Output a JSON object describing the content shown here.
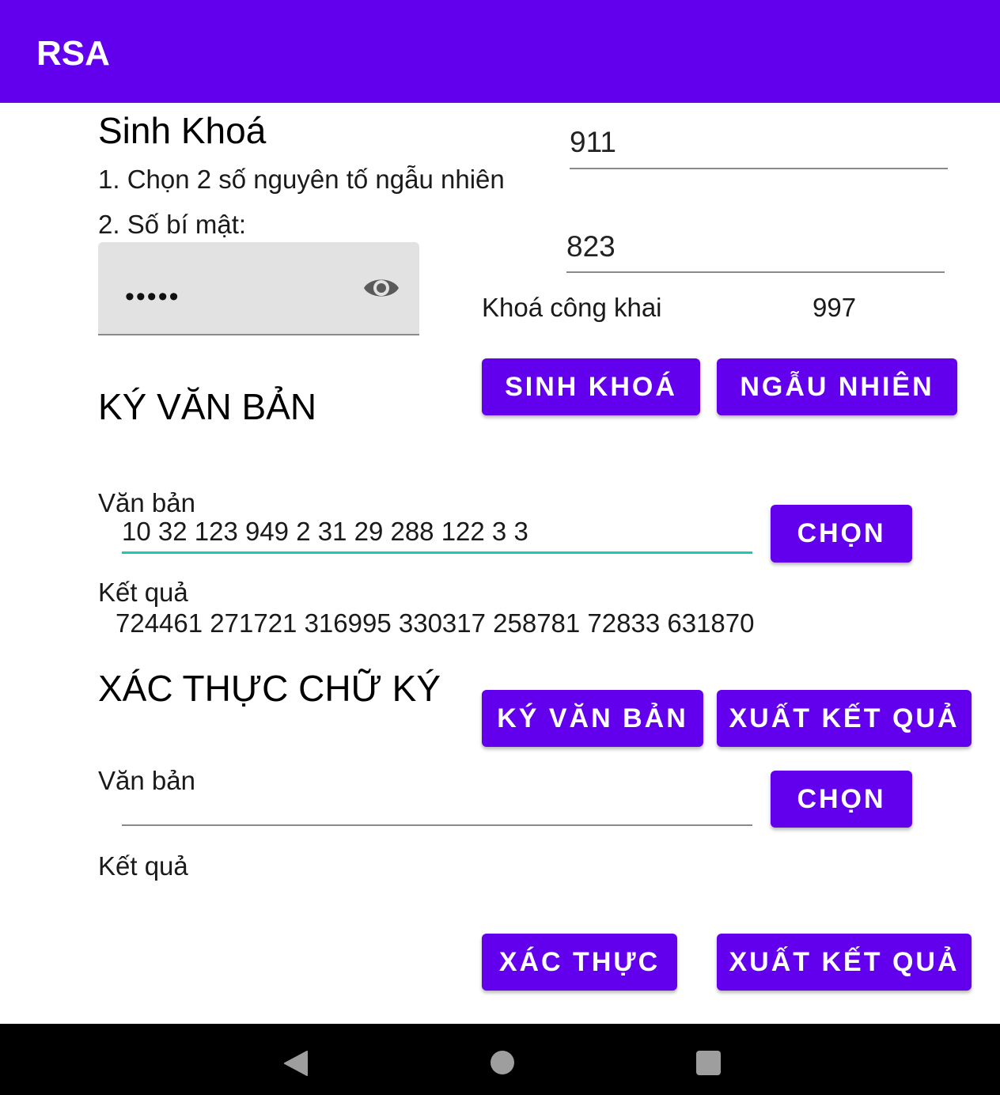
{
  "app": {
    "title": "RSA"
  },
  "keygen": {
    "heading": "Sinh Khoá",
    "step1_label": "1. Chọn 2 số nguyên tố ngẫu nhiên",
    "step2_label": "2. Số bí mật:",
    "prime1_value": "911",
    "prime2_value": "823",
    "secret_masked": "•••••",
    "public_key_label": "Khoá công khai",
    "public_key_value": "997",
    "generate_button": "SINH KHOÁ",
    "random_button": "NGẪU NHIÊN"
  },
  "sign": {
    "heading": "KÝ VĂN BẢN",
    "text_label": "Văn bản",
    "text_value": "10 32 123 949 2 31 29 288 122 3 3",
    "choose_button": "CHỌN",
    "result_label": "Kết quả",
    "result_value": "724461 271721 316995 330317 258781 72833 631870",
    "sign_button": "KÝ VĂN BẢN",
    "export_button": "XUẤT KẾT QUẢ"
  },
  "verify": {
    "heading": "XÁC THỰC CHỮ KÝ",
    "text_label": "Văn bản",
    "text_value": "",
    "choose_button": "CHỌN",
    "result_label": "Kết quả",
    "result_value": "",
    "verify_button": "XÁC THỰC",
    "export_button": "XUẤT KẾT QUẢ"
  },
  "colors": {
    "primary": "#6200ee",
    "accent": "#1fc8b5",
    "navbar": "#000000"
  },
  "icons": {
    "password_toggle": "eye-icon",
    "nav_back": "back-triangle-icon",
    "nav_home": "home-circle-icon",
    "nav_recents": "recents-square-icon"
  }
}
